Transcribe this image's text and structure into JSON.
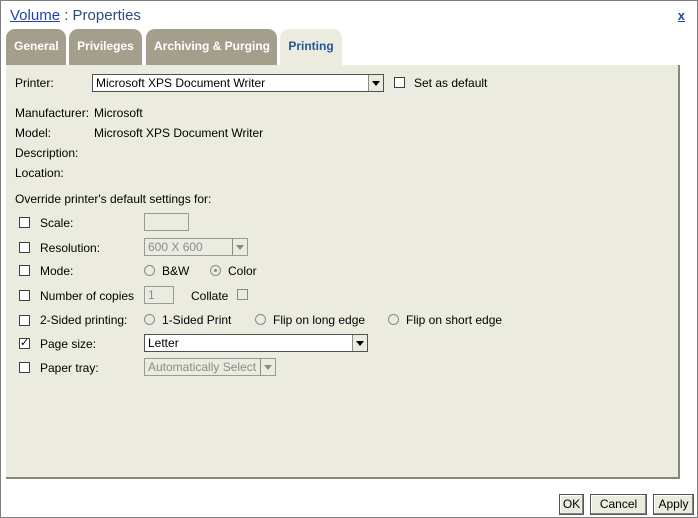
{
  "window": {
    "title_link": "Volume",
    "title_rest": " : Properties",
    "close_label": "x"
  },
  "tabs": [
    {
      "label": "General",
      "active": false
    },
    {
      "label": "Privileges",
      "active": false
    },
    {
      "label": "Archiving & Purging",
      "active": false
    },
    {
      "label": "Printing",
      "active": true
    }
  ],
  "printer": {
    "label": "Printer:",
    "selected": "Microsoft XPS Document Writer",
    "set_default_label": "Set as default",
    "set_default_checked": false
  },
  "info": {
    "manufacturer_label": "Manufacturer:",
    "manufacturer_value": "Microsoft",
    "model_label": "Model:",
    "model_value": "Microsoft XPS Document Writer",
    "description_label": "Description:",
    "location_label": "Location:"
  },
  "override": {
    "heading": "Override printer's default settings for:",
    "scale": {
      "label": "Scale:",
      "checked": false,
      "value": ""
    },
    "resolution": {
      "label": "Resolution:",
      "checked": false,
      "selected": "600 X 600"
    },
    "mode": {
      "label": "Mode:",
      "checked": false,
      "options": [
        "B&W",
        "Color"
      ],
      "selected": "Color"
    },
    "copies": {
      "label": "Number of copies",
      "checked": false,
      "value": "1",
      "collate_label": "Collate",
      "collate_checked": false
    },
    "two_sided": {
      "label": "2-Sided printing:",
      "checked": false,
      "options": [
        "1-Sided Print",
        "Flip on long edge",
        "Flip on short edge"
      ]
    },
    "page_size": {
      "label": "Page size:",
      "checked": true,
      "selected": "Letter"
    },
    "paper_tray": {
      "label": "Paper tray:",
      "checked": false,
      "selected": "Automatically Select"
    }
  },
  "buttons": {
    "ok": "OK",
    "cancel": "Cancel",
    "apply": "Apply"
  }
}
